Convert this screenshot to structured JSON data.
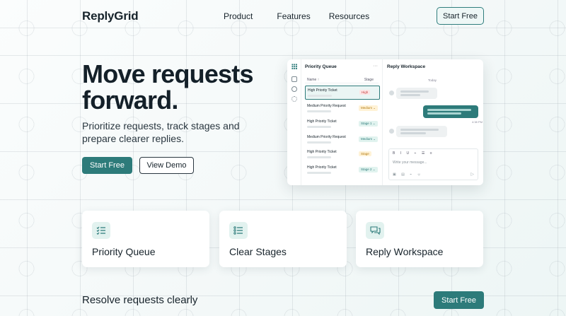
{
  "brand": {
    "name": "ReplyGrid",
    "accent": "#2d7b7a"
  },
  "nav": {
    "items": [
      "Product",
      "Features",
      "Resources"
    ],
    "cta": "Start Free"
  },
  "hero": {
    "title": "Move requests forward.",
    "subtitle": "Prioritize requests, track stages and prepare clearer replies.",
    "primary_cta": "Start Free",
    "secondary_cta": "View Demo"
  },
  "mockup": {
    "queue_title": "Priority Queue",
    "queue_menu": "···",
    "columns": {
      "name": "Name ↑",
      "stage": "Stage"
    },
    "rows": [
      {
        "name": "High Priority Ticket",
        "badge": "High"
      },
      {
        "name": "Medium Priority Request",
        "badge": "Medium ⌄"
      },
      {
        "name": "High Priority Ticket",
        "badge": "Stage 1 ⌄"
      },
      {
        "name": "Medium Priority Request",
        "badge": "Medium ⌄"
      },
      {
        "name": "High Priority Ticket",
        "badge": "Stage"
      },
      {
        "name": "High Priority Ticket",
        "badge": "Stage 2 ⌄"
      }
    ],
    "reply_title": "Reply Workspace",
    "day_label": "Today",
    "message_time": "4:38 PM",
    "editor_toolbar": "B I U ⌁ ☰ ≡",
    "editor_placeholder": "Write your message...",
    "editor_icons": "▣ ▤ ⌁ ☺",
    "send_icon": "▷"
  },
  "features": [
    {
      "label": "Priority Queue",
      "icon": "checklist-icon"
    },
    {
      "label": "Clear Stages",
      "icon": "list-icon"
    },
    {
      "label": "Reply Workspace",
      "icon": "chat-icon"
    }
  ],
  "footer_band": {
    "text": "Resolve requests clearly",
    "cta": "Start Free"
  }
}
